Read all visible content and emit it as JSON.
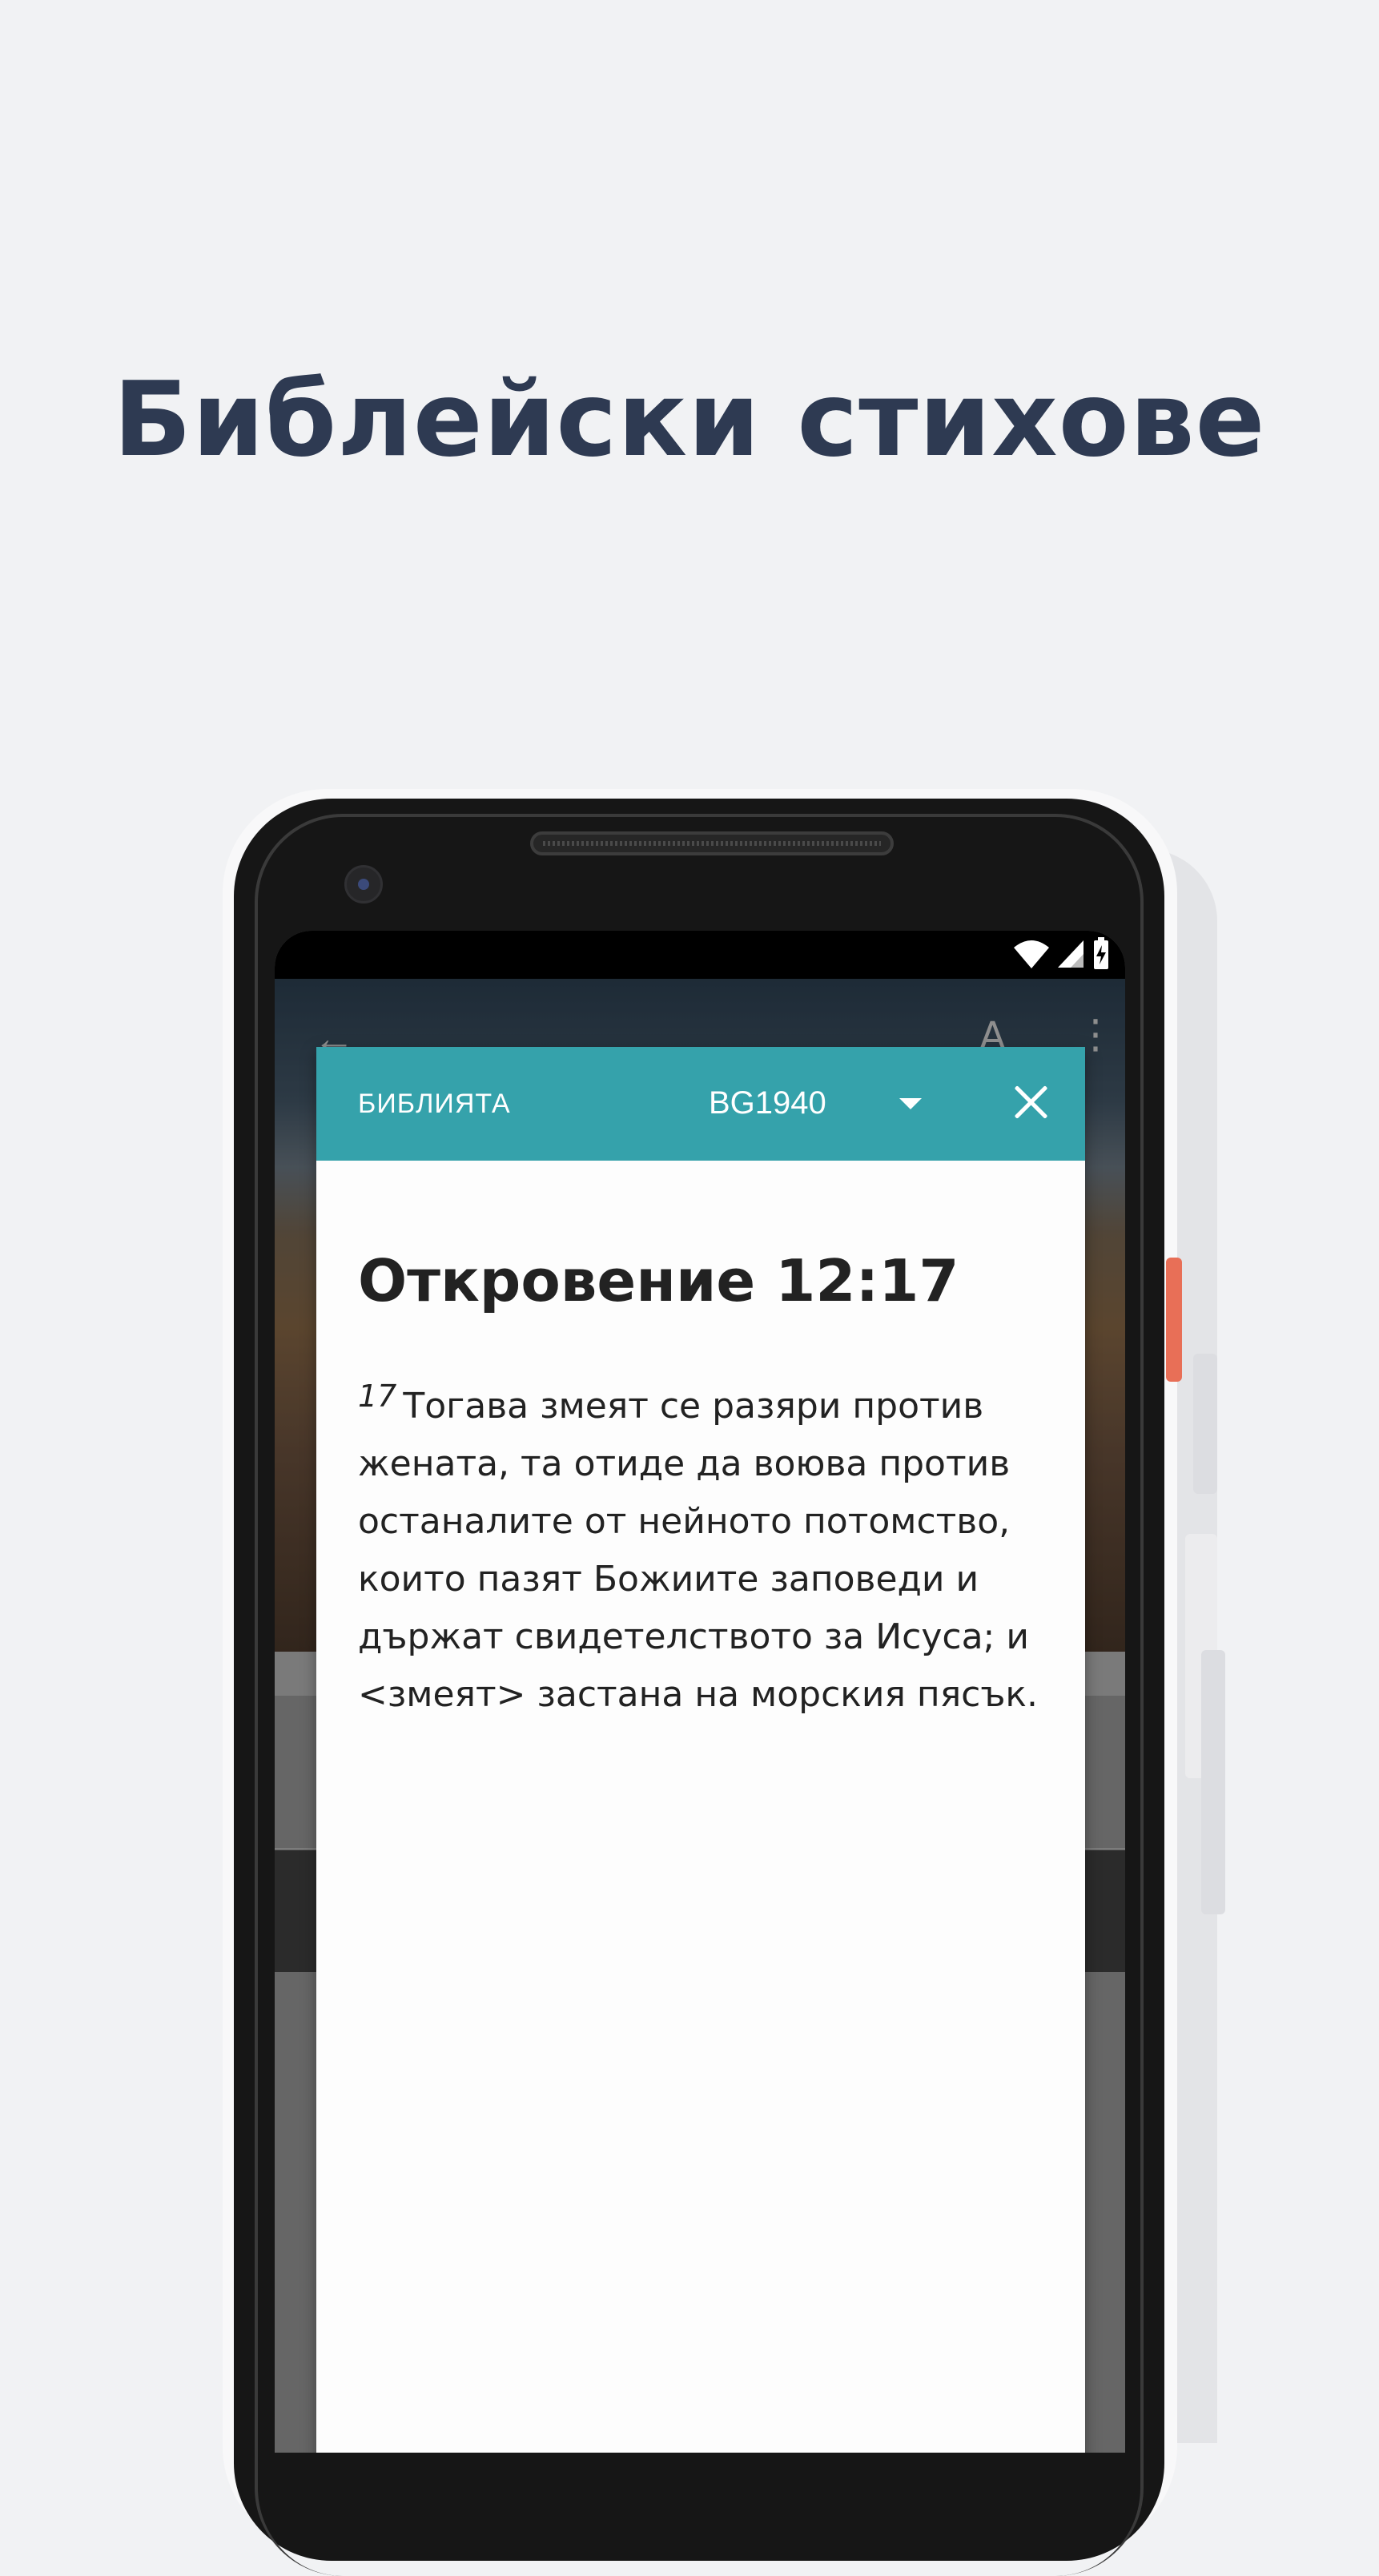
{
  "headline": "Библейски стихове",
  "app": {
    "back_icon": "arrow-left-icon",
    "font_icon": "font-size-icon",
    "more_icon": "more-vertical-icon",
    "font_glyph": "A"
  },
  "status_bar": {
    "icons": [
      "wifi-icon",
      "signal-icon",
      "battery-charging-icon"
    ]
  },
  "popup": {
    "source_label": "БИБЛИЯТА",
    "version": "BG1940",
    "reference": "Откровение 12:17",
    "verse_number": "17",
    "verse_text": "Тогава змеят се разяри против жената, та отиде да воюва против останалите от нейното потомство, които пазят Божиите заповеди и държат свидетелството за Исуса; и <змеят> застана на морския пясък.",
    "header_color": "#35a2ab"
  },
  "colors": {
    "background": "#f1f2f4",
    "headline": "#2e3a52",
    "accent_button": "#e86f57"
  }
}
